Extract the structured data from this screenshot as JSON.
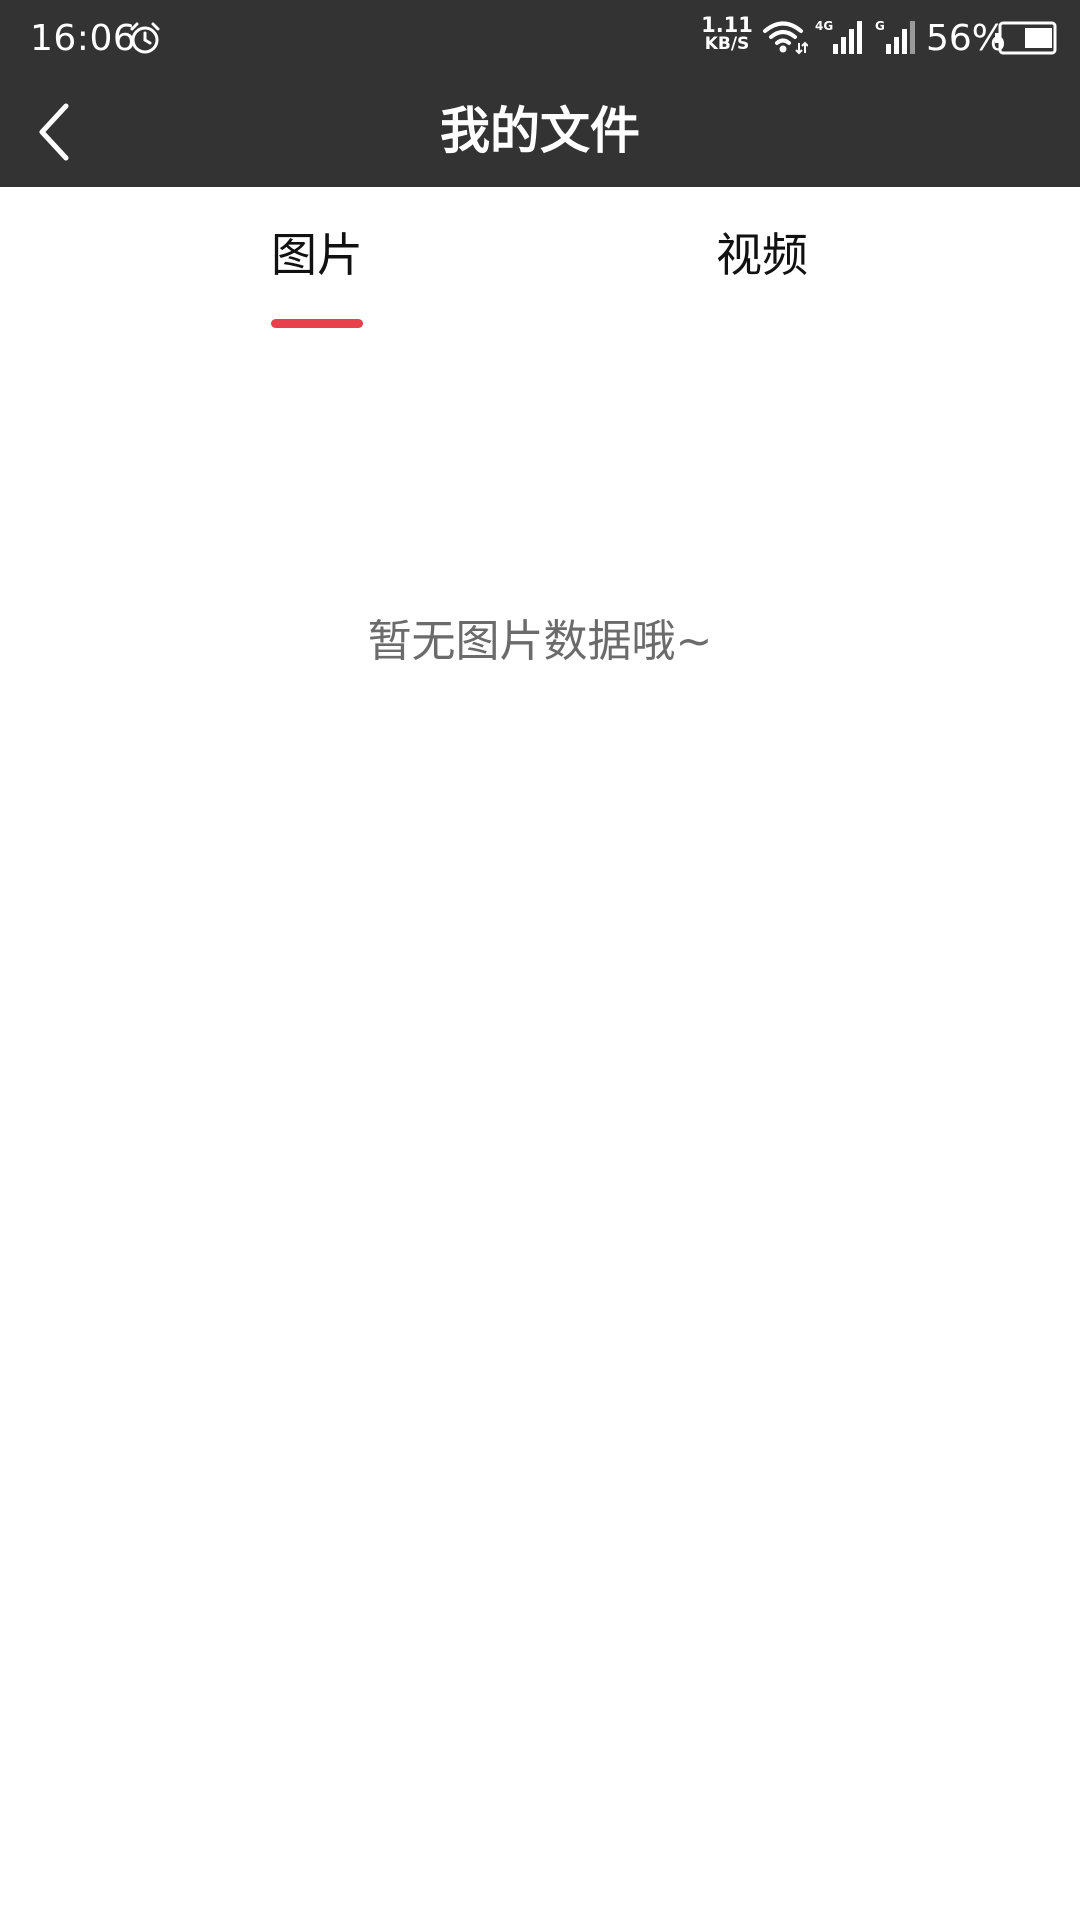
{
  "status_bar": {
    "time": "16:06",
    "alarm_icon": "alarm-clock-icon",
    "net_speed_value": "1.11",
    "net_speed_unit": "KB/S",
    "signal1_label": "4G",
    "signal2_label": "G",
    "battery_percent": "56%",
    "battery_level": 0.56
  },
  "header": {
    "title": "我的文件",
    "back_icon": "chevron-left-icon",
    "background_color": "#333333"
  },
  "tabs": [
    {
      "label": "图片",
      "active": true
    },
    {
      "label": "视频",
      "active": false
    }
  ],
  "accent_color": "#e8414c",
  "empty_state": {
    "message": "暂无图片数据哦~"
  }
}
